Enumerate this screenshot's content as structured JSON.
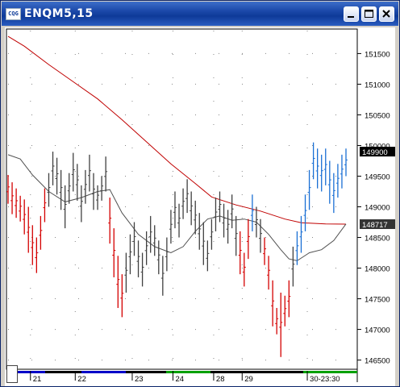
{
  "window": {
    "title": "ENQM5,15",
    "app_icon": "cqg-logo-icon",
    "buttons": [
      "minimize-icon",
      "maximize-icon",
      "close-icon"
    ]
  },
  "chart_data": {
    "type": "bar",
    "symbol": "ENQM5",
    "interval": "15",
    "y_axis": {
      "ticks": [
        146500,
        147000,
        147500,
        148000,
        148500,
        149000,
        149500,
        150000,
        150500,
        151000,
        151500
      ],
      "tick_labels": [
        "146500",
        "147000",
        "147500",
        "148000",
        "148500",
        "149000",
        "149500",
        "150000",
        "150500",
        "151000",
        "151500"
      ],
      "range": [
        146350,
        151900
      ]
    },
    "x_axis": {
      "labels": [
        "21",
        "22",
        "23",
        "24",
        "28",
        "29",
        "30-23:30"
      ],
      "label_index": [
        6,
        17,
        31,
        41,
        51,
        58,
        74
      ]
    },
    "price_markers": [
      {
        "label": "149900",
        "value": 149900,
        "color": "#000000"
      },
      {
        "label": "148717",
        "value": 148717,
        "color": "#333333"
      }
    ],
    "bars": [
      {
        "high": 149520,
        "low": 149050,
        "color": "red"
      },
      {
        "high": 149400,
        "low": 148880,
        "color": "red"
      },
      {
        "high": 149300,
        "low": 148820,
        "color": "red"
      },
      {
        "high": 149180,
        "low": 148760,
        "color": "red"
      },
      {
        "high": 149120,
        "low": 148550,
        "color": "red"
      },
      {
        "high": 149000,
        "low": 148250,
        "color": "red"
      },
      {
        "high": 148700,
        "low": 148050,
        "color": "red"
      },
      {
        "high": 148500,
        "low": 147920,
        "color": "red"
      },
      {
        "high": 148850,
        "low": 148300,
        "color": "red"
      },
      {
        "high": 149300,
        "low": 148750,
        "color": "red"
      },
      {
        "high": 149550,
        "low": 149000,
        "color": "grey"
      },
      {
        "high": 149900,
        "low": 149350,
        "color": "grey"
      },
      {
        "high": 149800,
        "low": 149200,
        "color": "grey"
      },
      {
        "high": 149600,
        "low": 148950,
        "color": "grey"
      },
      {
        "high": 149350,
        "low": 148650,
        "color": "grey"
      },
      {
        "high": 149550,
        "low": 149050,
        "color": "grey"
      },
      {
        "high": 149880,
        "low": 149250,
        "color": "grey"
      },
      {
        "high": 149700,
        "low": 149100,
        "color": "grey"
      },
      {
        "high": 149350,
        "low": 148750,
        "color": "grey"
      },
      {
        "high": 149600,
        "low": 149050,
        "color": "grey"
      },
      {
        "high": 149850,
        "low": 149250,
        "color": "grey"
      },
      {
        "high": 149550,
        "low": 148950,
        "color": "grey"
      },
      {
        "high": 149350,
        "low": 148950,
        "color": "grey"
      },
      {
        "high": 149500,
        "low": 149100,
        "color": "grey"
      },
      {
        "high": 149820,
        "low": 149250,
        "color": "grey"
      },
      {
        "high": 149150,
        "low": 148400,
        "color": "red"
      },
      {
        "high": 148650,
        "low": 147850,
        "color": "red"
      },
      {
        "high": 148200,
        "low": 147350,
        "color": "red"
      },
      {
        "high": 147900,
        "low": 147200,
        "color": "red"
      },
      {
        "high": 148250,
        "low": 147600,
        "color": "grey"
      },
      {
        "high": 148550,
        "low": 147900,
        "color": "grey"
      },
      {
        "high": 148750,
        "low": 148200,
        "color": "grey"
      },
      {
        "high": 148450,
        "low": 147850,
        "color": "grey"
      },
      {
        "high": 148250,
        "low": 147700,
        "color": "grey"
      },
      {
        "high": 148600,
        "low": 148050,
        "color": "grey"
      },
      {
        "high": 148850,
        "low": 148250,
        "color": "grey"
      },
      {
        "high": 148700,
        "low": 148200,
        "color": "grey"
      },
      {
        "high": 148450,
        "low": 147900,
        "color": "grey"
      },
      {
        "high": 148200,
        "low": 147550,
        "color": "grey"
      },
      {
        "high": 148500,
        "low": 147950,
        "color": "grey"
      },
      {
        "high": 148950,
        "low": 148400,
        "color": "grey"
      },
      {
        "high": 149250,
        "low": 148650,
        "color": "grey"
      },
      {
        "high": 149050,
        "low": 148500,
        "color": "grey"
      },
      {
        "high": 149300,
        "low": 148800,
        "color": "grey"
      },
      {
        "high": 149450,
        "low": 148900,
        "color": "grey"
      },
      {
        "high": 149250,
        "low": 148700,
        "color": "grey"
      },
      {
        "high": 149100,
        "low": 148550,
        "color": "grey"
      },
      {
        "high": 148900,
        "low": 148300,
        "color": "grey"
      },
      {
        "high": 148750,
        "low": 148050,
        "color": "grey"
      },
      {
        "high": 148450,
        "low": 147950,
        "color": "grey"
      },
      {
        "high": 148800,
        "low": 148300,
        "color": "grey"
      },
      {
        "high": 149150,
        "low": 148600,
        "color": "grey"
      },
      {
        "high": 149250,
        "low": 148750,
        "color": "grey"
      },
      {
        "high": 149050,
        "low": 148500,
        "color": "grey"
      },
      {
        "high": 148950,
        "low": 148400,
        "color": "grey"
      },
      {
        "high": 149200,
        "low": 148650,
        "color": "grey"
      },
      {
        "high": 148850,
        "low": 148200,
        "color": "grey"
      },
      {
        "high": 148600,
        "low": 147900,
        "color": "red"
      },
      {
        "high": 148250,
        "low": 147700,
        "color": "red"
      },
      {
        "high": 148800,
        "low": 148150,
        "color": "red"
      },
      {
        "high": 149200,
        "low": 148600,
        "color": "blue"
      },
      {
        "high": 149000,
        "low": 148500,
        "color": "grey"
      },
      {
        "high": 148800,
        "low": 148250,
        "color": "grey"
      },
      {
        "high": 148500,
        "low": 148050,
        "color": "red"
      },
      {
        "high": 148200,
        "low": 147650,
        "color": "red"
      },
      {
        "high": 147800,
        "low": 147050,
        "color": "red"
      },
      {
        "high": 147350,
        "low": 146920,
        "color": "red"
      },
      {
        "high": 147600,
        "low": 146550,
        "color": "red"
      },
      {
        "high": 147550,
        "low": 147050,
        "color": "red"
      },
      {
        "high": 147800,
        "low": 147200,
        "color": "red"
      },
      {
        "high": 148350,
        "low": 147700,
        "color": "grey"
      },
      {
        "high": 148600,
        "low": 148050,
        "color": "blue"
      },
      {
        "high": 148850,
        "low": 148250,
        "color": "blue"
      },
      {
        "high": 149200,
        "low": 148600,
        "color": "blue"
      },
      {
        "high": 149600,
        "low": 148950,
        "color": "blue"
      },
      {
        "high": 150050,
        "low": 149450,
        "color": "blue"
      },
      {
        "high": 149950,
        "low": 149300,
        "color": "blue"
      },
      {
        "high": 149850,
        "low": 149250,
        "color": "blue"
      },
      {
        "high": 149950,
        "low": 149350,
        "color": "blue"
      },
      {
        "high": 149750,
        "low": 149050,
        "color": "blue"
      },
      {
        "high": 149550,
        "low": 148900,
        "color": "blue"
      },
      {
        "high": 149700,
        "low": 149150,
        "color": "blue"
      },
      {
        "high": 149850,
        "low": 149300,
        "color": "blue"
      },
      {
        "high": 149950,
        "low": 149500,
        "color": "blue"
      }
    ],
    "moving_averages": [
      {
        "color": "#c00000",
        "points": [
          [
            0,
            151780
          ],
          [
            4,
            151620
          ],
          [
            10,
            151320
          ],
          [
            16,
            151040
          ],
          [
            22,
            150760
          ],
          [
            28,
            150420
          ],
          [
            34,
            150060
          ],
          [
            40,
            149700
          ],
          [
            46,
            149380
          ],
          [
            50,
            149160
          ],
          [
            56,
            149030
          ],
          [
            62,
            148930
          ],
          [
            68,
            148800
          ],
          [
            72,
            148740
          ],
          [
            78,
            148720
          ],
          [
            83,
            148717
          ]
        ]
      },
      {
        "color": "#505050",
        "points": [
          [
            0,
            149850
          ],
          [
            3,
            149780
          ],
          [
            6,
            149520
          ],
          [
            10,
            149250
          ],
          [
            14,
            149080
          ],
          [
            18,
            149150
          ],
          [
            22,
            149250
          ],
          [
            25,
            149280
          ],
          [
            28,
            148900
          ],
          [
            32,
            148550
          ],
          [
            36,
            148350
          ],
          [
            40,
            148250
          ],
          [
            43,
            148350
          ],
          [
            46,
            148600
          ],
          [
            49,
            148800
          ],
          [
            52,
            148850
          ],
          [
            55,
            148780
          ],
          [
            58,
            148800
          ],
          [
            61,
            148750
          ],
          [
            64,
            148550
          ],
          [
            67,
            148300
          ],
          [
            69,
            148150
          ],
          [
            71,
            148120
          ],
          [
            74,
            148250
          ],
          [
            77,
            148300
          ],
          [
            80,
            148450
          ],
          [
            83,
            148720
          ]
        ]
      }
    ],
    "colors": {
      "red": "#d40000",
      "grey": "#404040",
      "blue": "#1a6fd4"
    }
  }
}
